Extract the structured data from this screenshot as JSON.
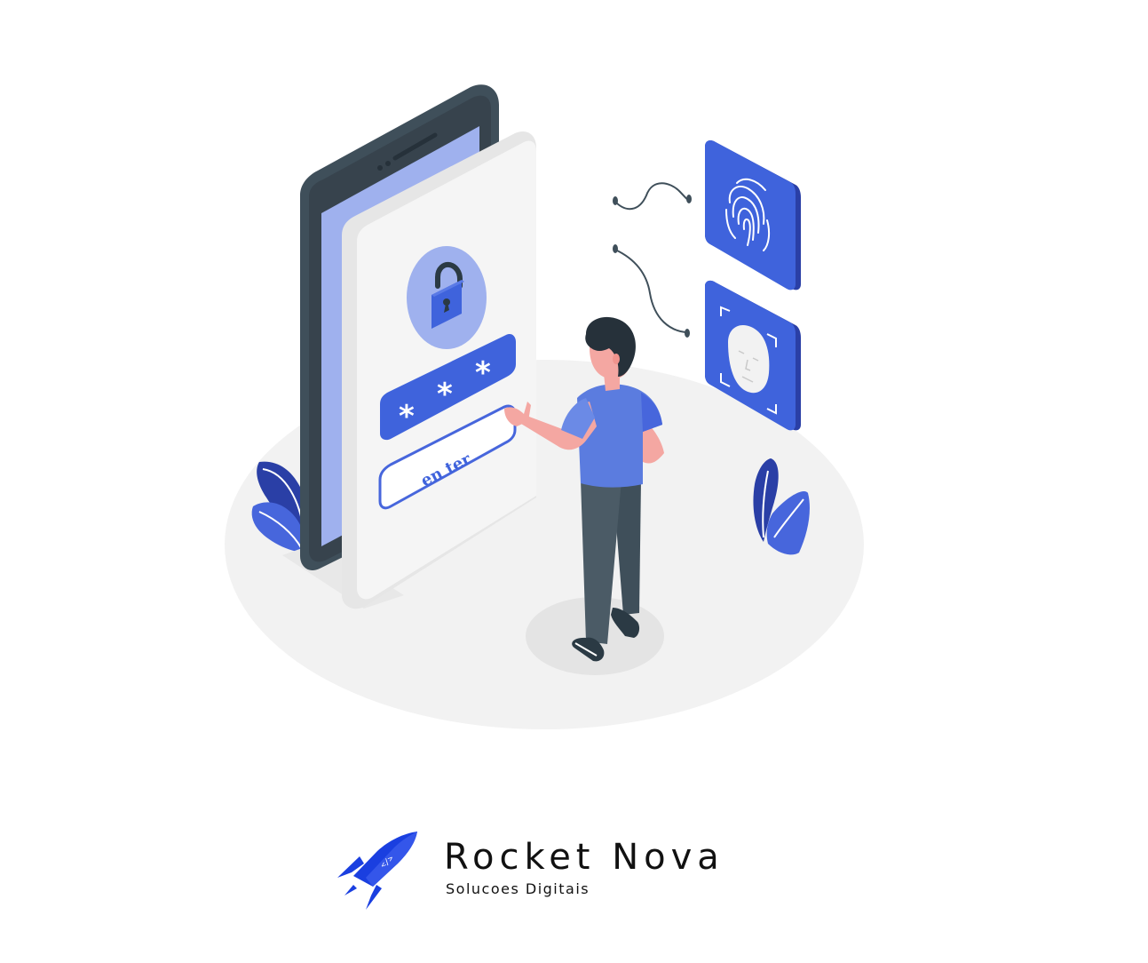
{
  "illustration": {
    "password_mask": "* * *",
    "enter_label": "en ter"
  },
  "brand": {
    "name": "Rocket Nova",
    "tagline": "Solucoes Digitais"
  },
  "colors": {
    "primary_blue": "#3f63dc",
    "light_blue": "#9fb1ee",
    "dark_slate": "#3f4f5a",
    "floor_gray": "#f2f2f2",
    "skin": "#f4a7a2",
    "rocket_blue": "#1a3fe0"
  },
  "icons": {
    "lock": "padlock-icon",
    "fingerprint": "fingerprint-icon",
    "face": "face-id-icon",
    "rocket": "rocket-logo-icon"
  }
}
